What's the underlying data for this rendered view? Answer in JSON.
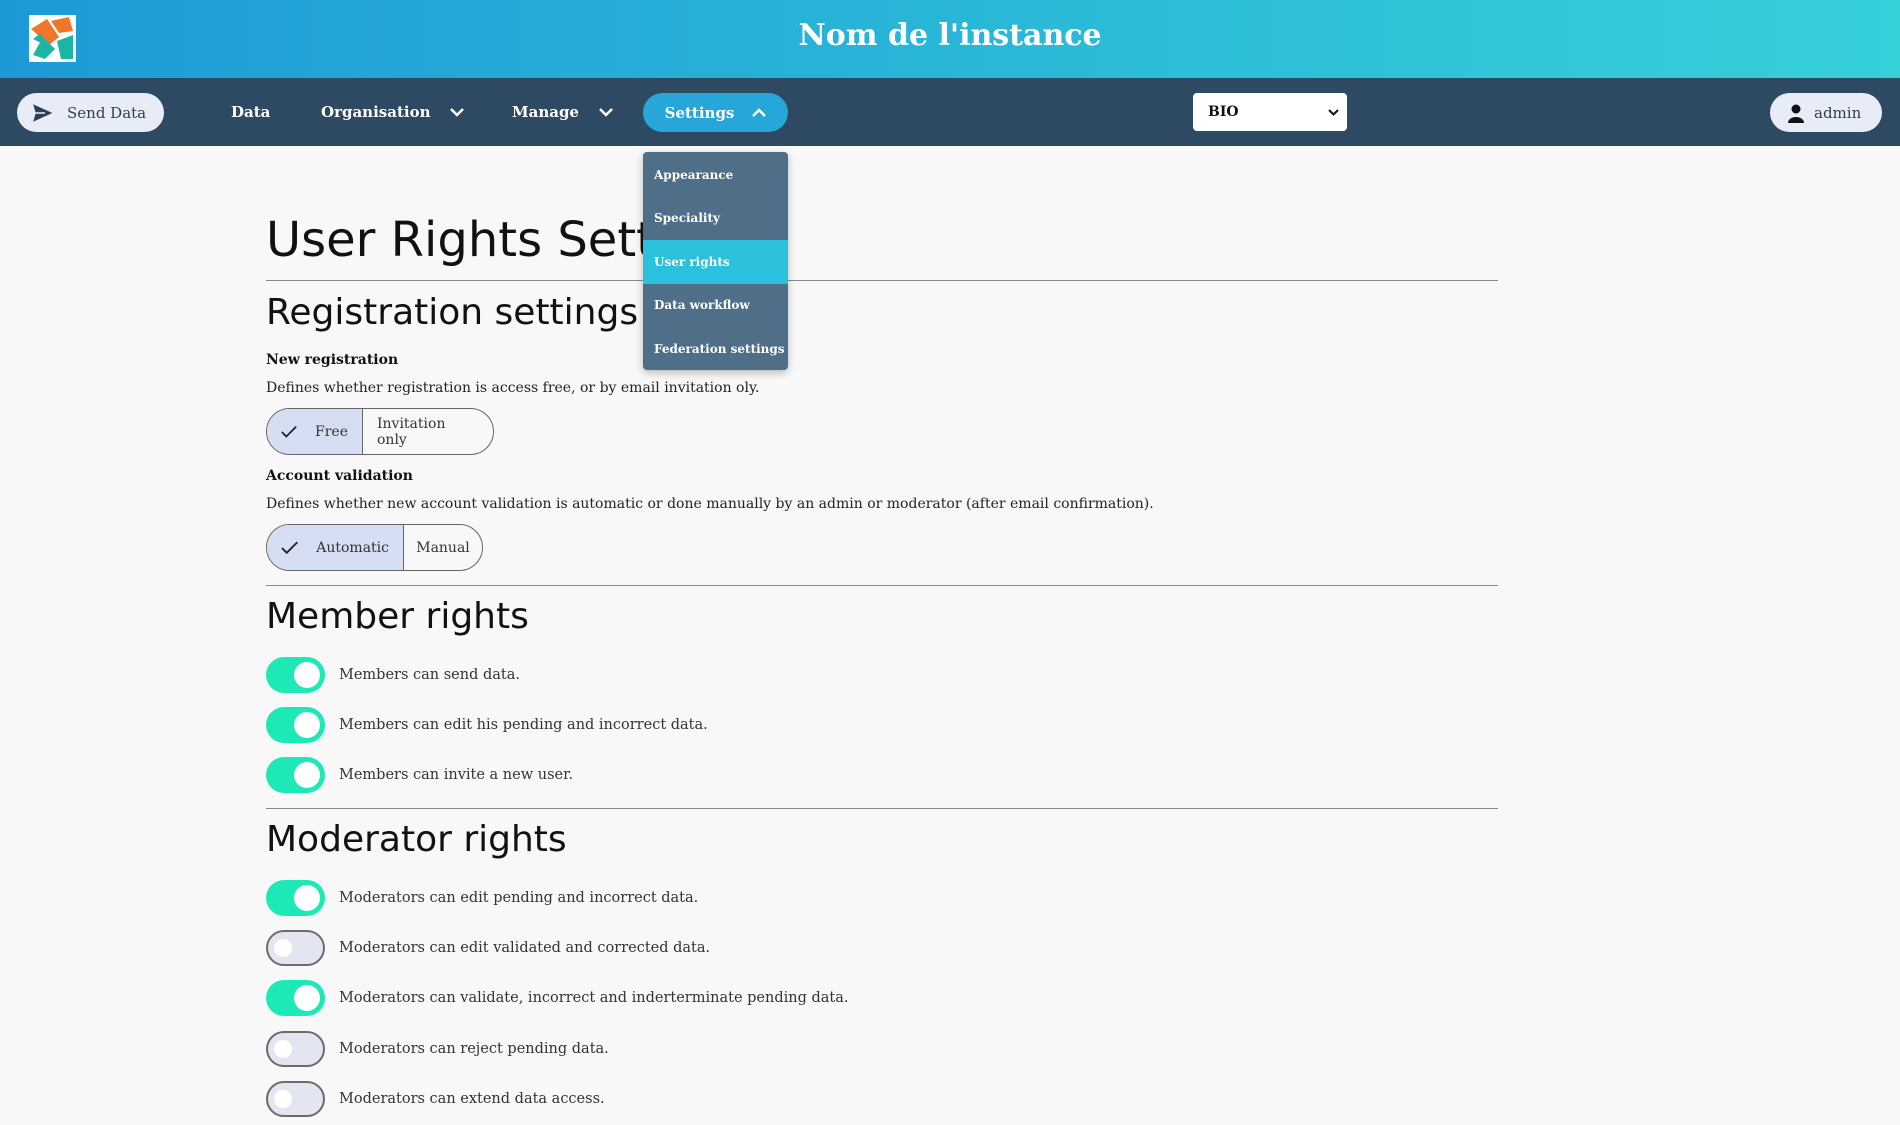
{
  "header": {
    "title": "Nom de l'instance",
    "logo_icon": "app-logo-icon"
  },
  "nav": {
    "send_label": "Send Data",
    "data_label": "Data",
    "organisation_label": "Organisation",
    "manage_label": "Manage",
    "settings_label": "Settings",
    "select_value": "BIO",
    "user_label": "admin"
  },
  "settings_menu": {
    "items": [
      {
        "label": "Appearance",
        "active": false
      },
      {
        "label": "Speciality",
        "active": false
      },
      {
        "label": "User rights",
        "active": true
      },
      {
        "label": "Data workflow",
        "active": false
      },
      {
        "label": "Federation settings",
        "active": false
      }
    ]
  },
  "page": {
    "title": "User Rights Settings",
    "registration": {
      "title": "Registration settings",
      "new_registration": {
        "label": "New registration",
        "desc": "Defines whether registration is access free, or by email invitation oly.",
        "options": [
          "Free",
          "Invitation only"
        ],
        "selected": "Free"
      },
      "account_validation": {
        "label": "Account validation",
        "desc": "Defines whether new account validation is automatic or done manually by an admin or moderator (after email confirmation).",
        "options": [
          "Automatic",
          "Manual"
        ],
        "selected": "Automatic"
      }
    },
    "member_rights": {
      "title": "Member rights",
      "items": [
        {
          "label": "Members can send data.",
          "on": true
        },
        {
          "label": "Members can edit his pending and incorrect data.",
          "on": true
        },
        {
          "label": "Members can invite a new user.",
          "on": true
        }
      ]
    },
    "moderator_rights": {
      "title": "Moderator rights",
      "items": [
        {
          "label": "Moderators can edit pending and incorrect data.",
          "on": true
        },
        {
          "label": "Moderators can edit validated and corrected data.",
          "on": false
        },
        {
          "label": "Moderators can validate, incorrect and inderterminate pending data.",
          "on": true
        },
        {
          "label": "Moderators can reject pending data.",
          "on": false
        },
        {
          "label": "Moderators can extend data access.",
          "on": false
        }
      ]
    }
  },
  "colors": {
    "header_start": "#1d9ad6",
    "header_end": "#36d0d9",
    "nav": "#2e4a62",
    "accent": "#27a6d9",
    "toggle_on": "#1de9b6"
  }
}
